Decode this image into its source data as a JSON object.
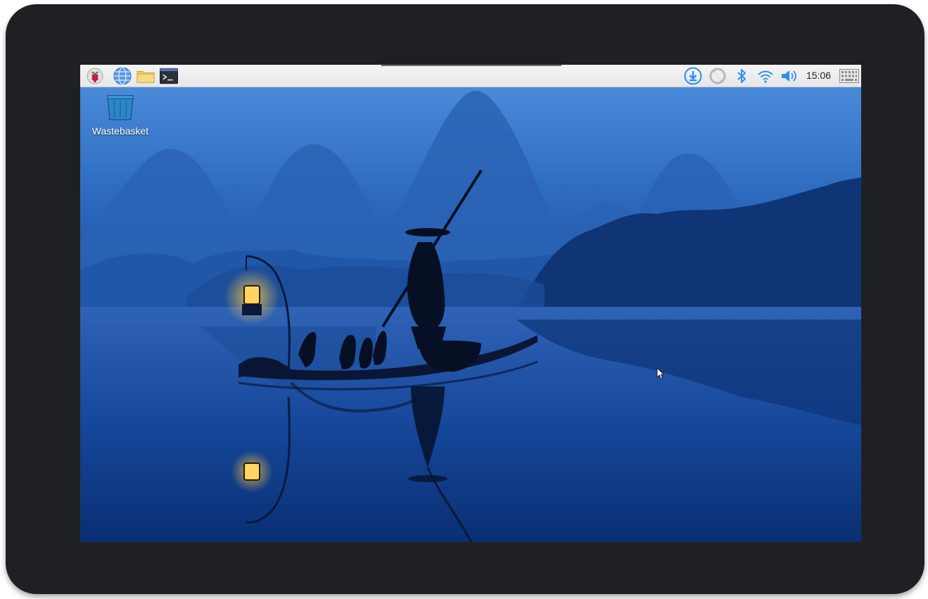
{
  "taskbar": {
    "launchers": [
      {
        "name": "menu",
        "icon": "raspberry-icon"
      },
      {
        "name": "browser",
        "icon": "globe-icon"
      },
      {
        "name": "file-manager",
        "icon": "folder-icon"
      },
      {
        "name": "terminal",
        "icon": "terminal-icon"
      }
    ],
    "tray": [
      {
        "icon": "updates-download-icon"
      },
      {
        "icon": "sync-icon"
      },
      {
        "icon": "bluetooth-icon"
      },
      {
        "icon": "wifi-icon"
      },
      {
        "icon": "volume-icon"
      }
    ],
    "clock": "15:06",
    "keyboard_icon": "virtual-keyboard-icon"
  },
  "desktop": {
    "icons": [
      {
        "label": "Wastebasket",
        "icon": "wastebasket-icon"
      }
    ],
    "wallpaper": "misty karst mountains, river, fisherman on raft with lantern and cormorants"
  },
  "colors": {
    "panel": "#ececec",
    "accent": "#2d8ff0",
    "sky": "#3f7fcf",
    "water": "#0d3a86",
    "bezel": "#1f2023"
  }
}
